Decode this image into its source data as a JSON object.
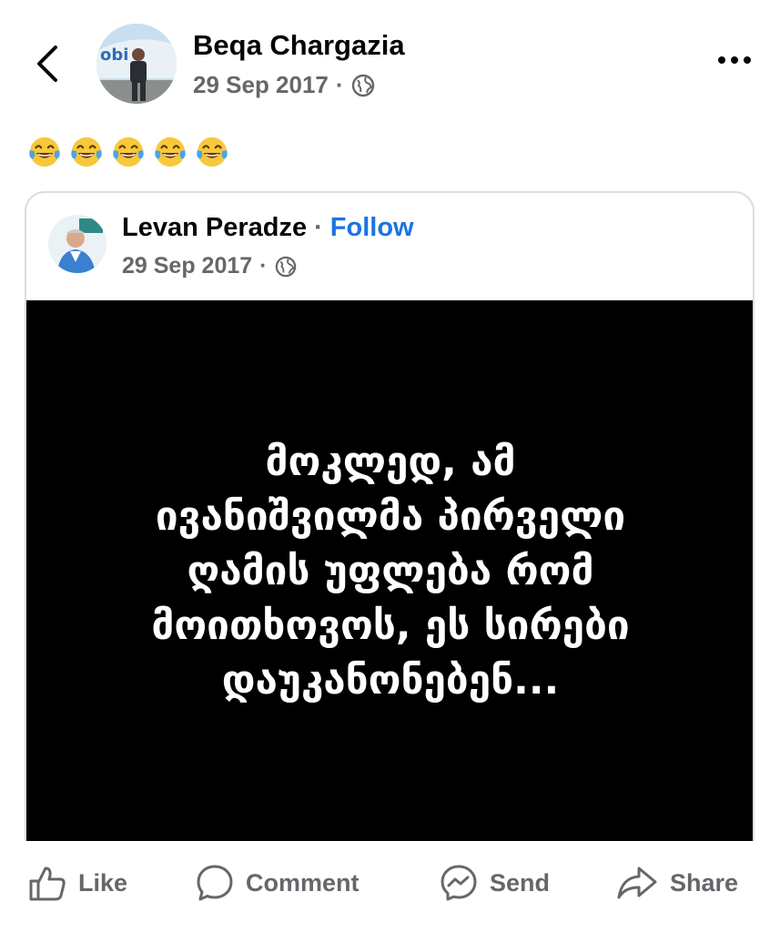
{
  "header": {
    "back_icon": "chevron-left-icon",
    "author": "Beqa Chargazia",
    "date": "29 Sep 2017",
    "separator": "·",
    "privacy_icon": "globe-icon",
    "more_icon": "more-horizontal-icon"
  },
  "caption": {
    "emoji_name": "face-with-tears-of-joy-icon",
    "emoji_count": 5
  },
  "shared_post": {
    "author": "Levan Peradze",
    "separator": "·",
    "follow_label": "Follow",
    "date": "29 Sep 2017",
    "privacy_icon": "globe-icon",
    "text": "მოკლედ, ამ\nივანიშვილმა პირველი\nღამის უფლება რომ\nმოითხოვოს, ეს სირები\nდაუკანონებენ..."
  },
  "actions": {
    "like": "Like",
    "comment": "Comment",
    "send": "Send",
    "share": "Share"
  },
  "colors": {
    "follow": "#1b74e4",
    "muted": "#65676b",
    "post_background": "#000000",
    "post_text": "#ffffff"
  }
}
